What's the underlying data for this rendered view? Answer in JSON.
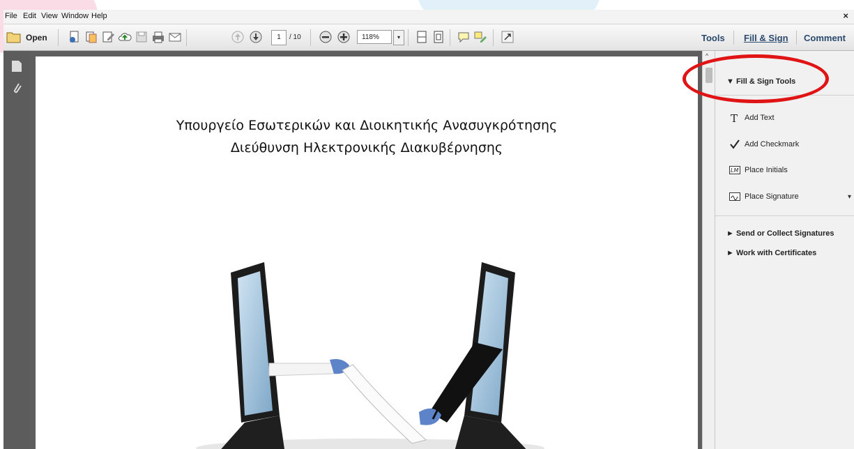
{
  "menu": {
    "items": [
      "File",
      "Edit",
      "View",
      "Window",
      "Help"
    ],
    "close": "×"
  },
  "toolbar": {
    "open_label": "Open",
    "page_current": "1",
    "page_total": "/ 10",
    "zoom": "118%",
    "zoom_arrow": "▾"
  },
  "right_tabs": {
    "tools": "Tools",
    "fill_sign": "Fill & Sign",
    "comment": "Comment"
  },
  "panel": {
    "section_title": "▼ Fill & Sign Tools",
    "tools": [
      {
        "label": "Add Text"
      },
      {
        "label": "Add Checkmark"
      },
      {
        "label": "Place Initials"
      },
      {
        "label": "Place Signature"
      }
    ],
    "signature_arrow": "▾",
    "send_collect": "► Send or Collect Signatures",
    "certificates": "► Work with Certificates"
  },
  "document": {
    "title_line1": "Υπουργείο Εσωτερικών και Διοικητικής Ανασυγκρότησης",
    "title_line2": "Διεύθυνση Ηλεκτρονικής Διακυβέρνησης"
  },
  "colors": {
    "highlight_circle": "#e01414",
    "tab_text": "#2a4a6e"
  }
}
